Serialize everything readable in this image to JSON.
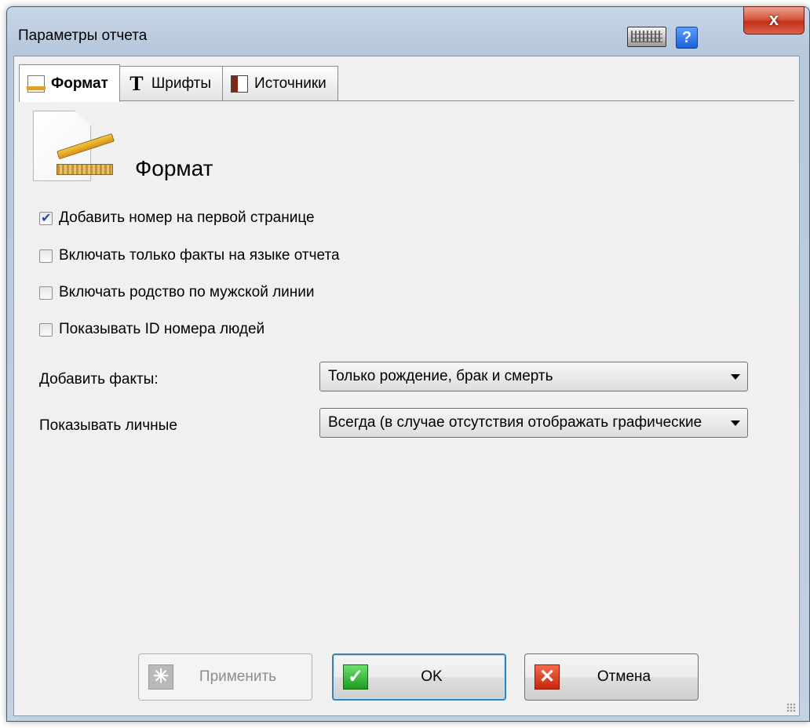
{
  "window": {
    "title": "Параметры отчета",
    "close_label": "x",
    "help_label": "?"
  },
  "tabs": [
    {
      "label": "Формат",
      "icon": "format-page-icon",
      "active": true
    },
    {
      "label": "Шрифты",
      "icon": "font-icon",
      "active": false
    },
    {
      "label": "Источники",
      "icon": "sources-book-icon",
      "active": false
    }
  ],
  "panel": {
    "title": "Формат",
    "checkboxes": [
      {
        "label": "Добавить номер на первой странице",
        "checked": true
      },
      {
        "label": "Включать только факты на языке отчета",
        "checked": false
      },
      {
        "label": "Включать родство по мужской линии",
        "checked": false
      },
      {
        "label": "Показывать ID номера людей",
        "checked": false
      }
    ],
    "add_facts": {
      "label": "Добавить факты:",
      "value": "Только рождение, брак и смерть"
    },
    "show_personal": {
      "label": "Показывать личные",
      "value": "Всегда (в случае отсутствия отображать графические"
    }
  },
  "buttons": {
    "apply": "Применить",
    "ok": "OK",
    "cancel": "Отмена"
  }
}
